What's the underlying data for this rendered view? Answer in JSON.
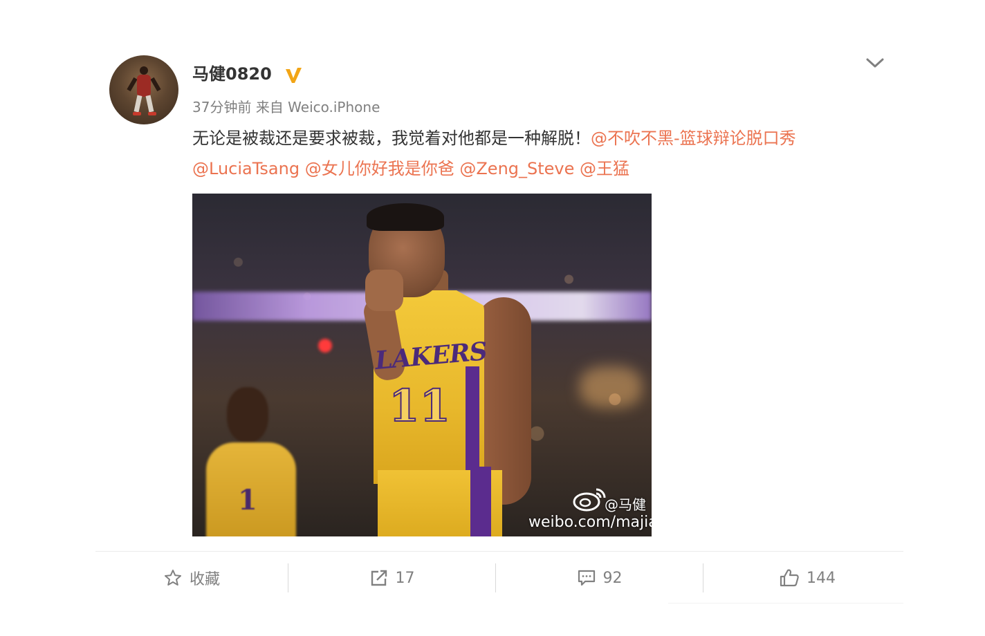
{
  "post": {
    "author": "马健0820",
    "time": "37分钟前",
    "source_prefix": "来自",
    "source": "Weico.iPhone",
    "text": "无论是被裁还是要求被裁，我觉着对他都是一种解脱！",
    "mentions": [
      "@不吹不黑-篮球辩论脱口秀",
      "@LuciaTsang",
      "@女儿你好我是你爸",
      "@Zeng_Steve",
      "@王猛"
    ],
    "image": {
      "jersey_text": "LAKERS",
      "jersey_number": "11",
      "background_number": "1",
      "watermark_handle": "@马健",
      "watermark_url": "weibo.com/majia"
    }
  },
  "actions": {
    "favorite_label": "收藏",
    "repost_count": "17",
    "comment_count": "92",
    "like_count": "144"
  },
  "colors": {
    "mention": "#eb7350",
    "verified": "#f2a516",
    "muted": "#808080"
  },
  "icons": [
    "verified-icon",
    "chevron-down-icon",
    "star-icon",
    "share-icon",
    "comment-icon",
    "thumbs-up-icon",
    "weibo-logo-icon"
  ]
}
